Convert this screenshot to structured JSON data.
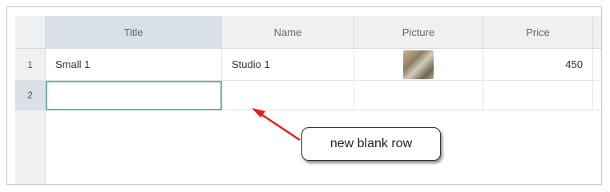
{
  "table": {
    "columns": [
      "Title",
      "Name",
      "Picture",
      "Price"
    ],
    "rows": [
      {
        "num": "1",
        "title": "Small 1",
        "name": "Studio 1",
        "picture": "photo-thumbnail",
        "price": "450"
      },
      {
        "num": "2",
        "title": "",
        "name": "",
        "picture": "",
        "price": ""
      }
    ]
  },
  "annotation": {
    "label": "new blank row"
  },
  "colors": {
    "selection": "#68b8a4",
    "arrow": "#e0201f",
    "header": "#eef0f2",
    "active_header": "#d9e0e8"
  }
}
